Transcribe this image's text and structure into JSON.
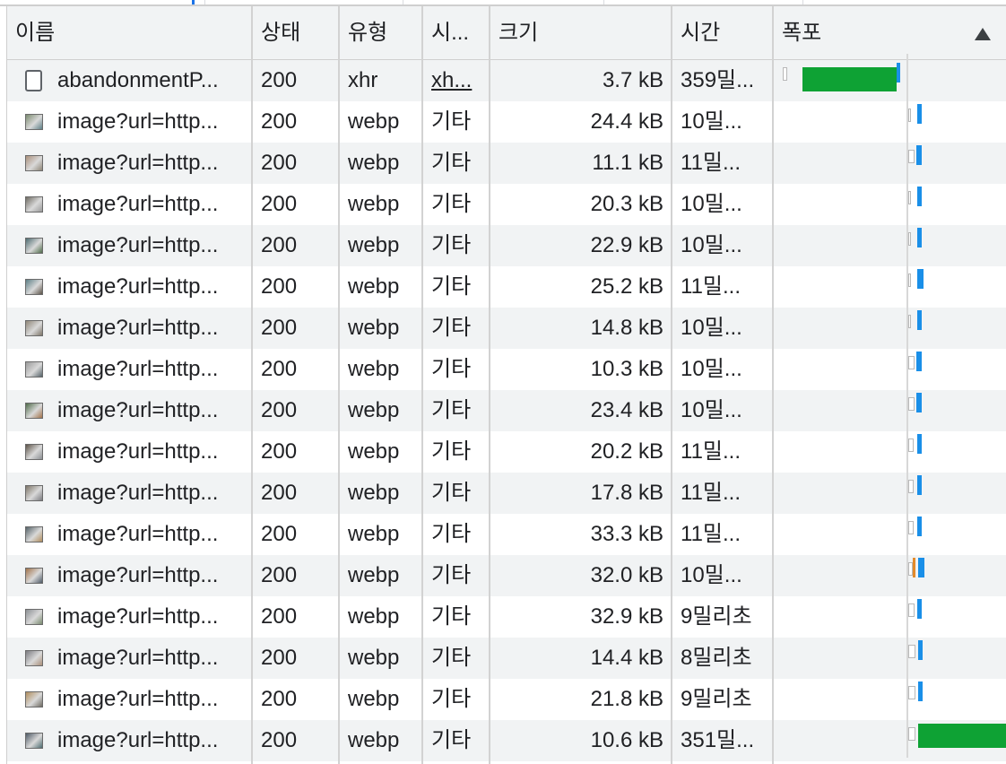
{
  "columns": {
    "name": "이름",
    "status": "상태",
    "type": "유형",
    "initiator": "시...",
    "size": "크기",
    "time": "시간",
    "waterfall": "폭포"
  },
  "colors": {
    "download": "#0ea234",
    "blue": "#1a8fe8",
    "header_bg": "#f1f3f4",
    "tab_accent": "#1a73e8"
  },
  "rows": [
    {
      "name": "abandonmentP...",
      "status": "200",
      "type": "xhr",
      "initiator": "xh...",
      "size": "3.7 kB",
      "time": "359밀...",
      "icon": "document-icon"
    },
    {
      "name": "image?url=http...",
      "status": "200",
      "type": "webp",
      "initiator": "기타",
      "size": "24.4 kB",
      "time": "10밀...",
      "icon": "image-thumbnail-icon"
    },
    {
      "name": "image?url=http...",
      "status": "200",
      "type": "webp",
      "initiator": "기타",
      "size": "11.1 kB",
      "time": "11밀...",
      "icon": "image-thumbnail-icon"
    },
    {
      "name": "image?url=http...",
      "status": "200",
      "type": "webp",
      "initiator": "기타",
      "size": "20.3 kB",
      "time": "10밀...",
      "icon": "image-thumbnail-icon"
    },
    {
      "name": "image?url=http...",
      "status": "200",
      "type": "webp",
      "initiator": "기타",
      "size": "22.9 kB",
      "time": "10밀...",
      "icon": "image-thumbnail-icon"
    },
    {
      "name": "image?url=http...",
      "status": "200",
      "type": "webp",
      "initiator": "기타",
      "size": "25.2 kB",
      "time": "11밀...",
      "icon": "image-thumbnail-icon"
    },
    {
      "name": "image?url=http...",
      "status": "200",
      "type": "webp",
      "initiator": "기타",
      "size": "14.8 kB",
      "time": "10밀...",
      "icon": "image-thumbnail-icon"
    },
    {
      "name": "image?url=http...",
      "status": "200",
      "type": "webp",
      "initiator": "기타",
      "size": "10.3 kB",
      "time": "10밀...",
      "icon": "image-thumbnail-icon"
    },
    {
      "name": "image?url=http...",
      "status": "200",
      "type": "webp",
      "initiator": "기타",
      "size": "23.4 kB",
      "time": "10밀...",
      "icon": "image-thumbnail-icon"
    },
    {
      "name": "image?url=http...",
      "status": "200",
      "type": "webp",
      "initiator": "기타",
      "size": "20.2 kB",
      "time": "11밀...",
      "icon": "image-thumbnail-icon"
    },
    {
      "name": "image?url=http...",
      "status": "200",
      "type": "webp",
      "initiator": "기타",
      "size": "17.8 kB",
      "time": "11밀...",
      "icon": "image-thumbnail-icon"
    },
    {
      "name": "image?url=http...",
      "status": "200",
      "type": "webp",
      "initiator": "기타",
      "size": "33.3 kB",
      "time": "11밀...",
      "icon": "image-thumbnail-icon"
    },
    {
      "name": "image?url=http...",
      "status": "200",
      "type": "webp",
      "initiator": "기타",
      "size": "32.0 kB",
      "time": "10밀...",
      "icon": "image-thumbnail-icon"
    },
    {
      "name": "image?url=http...",
      "status": "200",
      "type": "webp",
      "initiator": "기타",
      "size": "32.9 kB",
      "time": " 9밀리초",
      "icon": "image-thumbnail-icon"
    },
    {
      "name": "image?url=http...",
      "status": "200",
      "type": "webp",
      "initiator": "기타",
      "size": "14.4 kB",
      "time": " 8밀리초",
      "icon": "image-thumbnail-icon"
    },
    {
      "name": "image?url=http...",
      "status": "200",
      "type": "webp",
      "initiator": "기타",
      "size": "21.8 kB",
      "time": " 9밀리초",
      "icon": "image-thumbnail-icon"
    },
    {
      "name": "image?url=http...",
      "status": "200",
      "type": "webp",
      "initiator": "기타",
      "size": "10.6 kB",
      "time": "351밀...",
      "icon": "image-thumbnail-icon"
    }
  ]
}
